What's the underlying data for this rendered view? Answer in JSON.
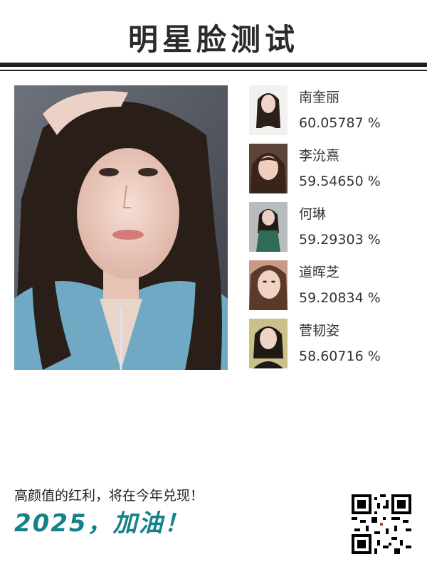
{
  "header": {
    "title": "明星脸测试"
  },
  "matches": [
    {
      "name": "南奎丽",
      "score": "60.05787 %",
      "thumb_bg": "#f3f1ef",
      "hair": "#2a1f1a",
      "cloth": "#f5f2ee"
    },
    {
      "name": "李沇熹",
      "score": "59.54650 %",
      "thumb_bg": "#5c4438",
      "hair": "#3a2419",
      "cloth": "#6b4a3a"
    },
    {
      "name": "何琳",
      "score": "59.29303 %",
      "thumb_bg": "#b9bcbd",
      "hair": "#221a16",
      "cloth": "#2f6b55"
    },
    {
      "name": "道晖芝",
      "score": "59.20834 %",
      "thumb_bg": "#c99b84",
      "hair": "#5a3a2a",
      "cloth": "#d6b09a"
    },
    {
      "name": "菅韧姿",
      "score": "58.60716 %",
      "thumb_bg": "#c9c08a",
      "hair": "#1f1814",
      "cloth": "#1a1a1a"
    }
  ],
  "footer": {
    "tagline": "高颜值的红利，将在今年兑现！",
    "slogan": "2025，加油！",
    "slogan_color": "#13838a"
  }
}
